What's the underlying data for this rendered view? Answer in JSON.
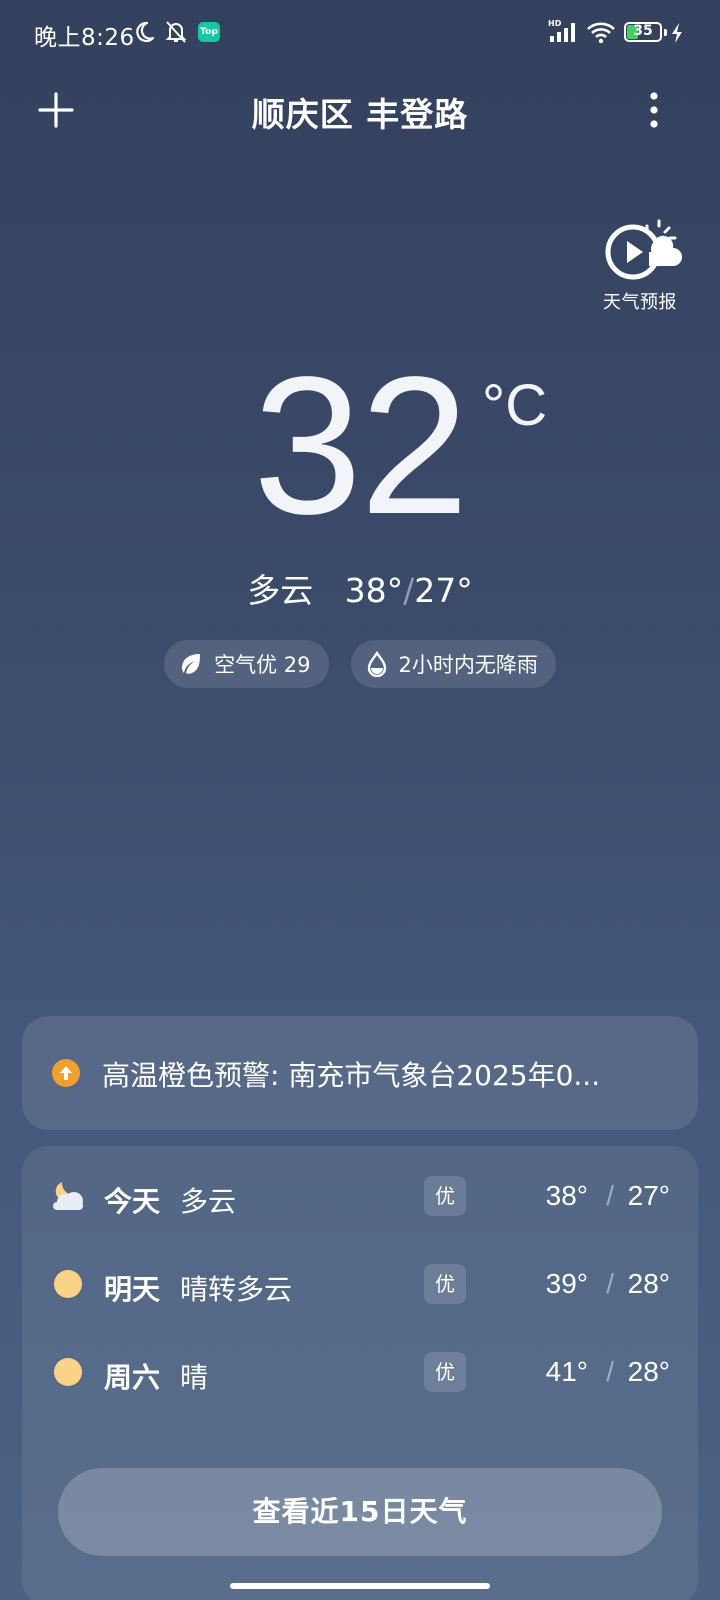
{
  "status_bar": {
    "time": "晚上8:26",
    "top_badge": "Top",
    "battery": "35",
    "battery_level_percent": 35
  },
  "header": {
    "title": "顺庆区 丰登路",
    "forecast_video_label": "天气预报"
  },
  "current": {
    "temperature": "32",
    "unit": "°C",
    "condition": "多云",
    "high": "38°",
    "slash": "/",
    "low": "27°",
    "air_chip": "空气优 29",
    "rain_chip": "2小时内无降雨"
  },
  "alert": {
    "text": "高温橙色预警: 南充市气象台2025年0..."
  },
  "forecast": {
    "days": [
      {
        "day": "今天",
        "condition": "多云",
        "aqi": "优",
        "high": "38°",
        "sep": "/",
        "low": "27°",
        "icon": "partly-cloudy-night-icon"
      },
      {
        "day": "明天",
        "condition": "晴转多云",
        "aqi": "优",
        "high": "39°",
        "sep": "/",
        "low": "28°",
        "icon": "sun-icon"
      },
      {
        "day": "周六",
        "condition": "晴",
        "aqi": "优",
        "high": "41°",
        "sep": "/",
        "low": "28°",
        "icon": "sun-icon"
      }
    ],
    "button_label": "查看近15日天气"
  },
  "colors": {
    "alert_orange": "#f2a02a",
    "sun_yellow": "#fbd384",
    "battery_green": "#3bd35a"
  }
}
